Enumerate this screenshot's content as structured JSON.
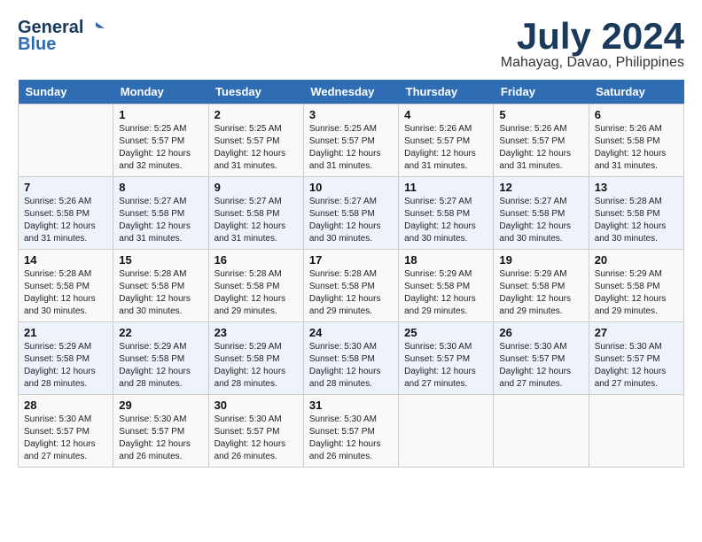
{
  "header": {
    "logo_line1": "General",
    "logo_line2": "Blue",
    "month_year": "July 2024",
    "location": "Mahayag, Davao, Philippines"
  },
  "days_of_week": [
    "Sunday",
    "Monday",
    "Tuesday",
    "Wednesday",
    "Thursday",
    "Friday",
    "Saturday"
  ],
  "weeks": [
    [
      {
        "day": "",
        "info": ""
      },
      {
        "day": "1",
        "info": "Sunrise: 5:25 AM\nSunset: 5:57 PM\nDaylight: 12 hours\nand 32 minutes."
      },
      {
        "day": "2",
        "info": "Sunrise: 5:25 AM\nSunset: 5:57 PM\nDaylight: 12 hours\nand 31 minutes."
      },
      {
        "day": "3",
        "info": "Sunrise: 5:25 AM\nSunset: 5:57 PM\nDaylight: 12 hours\nand 31 minutes."
      },
      {
        "day": "4",
        "info": "Sunrise: 5:26 AM\nSunset: 5:57 PM\nDaylight: 12 hours\nand 31 minutes."
      },
      {
        "day": "5",
        "info": "Sunrise: 5:26 AM\nSunset: 5:57 PM\nDaylight: 12 hours\nand 31 minutes."
      },
      {
        "day": "6",
        "info": "Sunrise: 5:26 AM\nSunset: 5:58 PM\nDaylight: 12 hours\nand 31 minutes."
      }
    ],
    [
      {
        "day": "7",
        "info": "Sunrise: 5:26 AM\nSunset: 5:58 PM\nDaylight: 12 hours\nand 31 minutes."
      },
      {
        "day": "8",
        "info": "Sunrise: 5:27 AM\nSunset: 5:58 PM\nDaylight: 12 hours\nand 31 minutes."
      },
      {
        "day": "9",
        "info": "Sunrise: 5:27 AM\nSunset: 5:58 PM\nDaylight: 12 hours\nand 31 minutes."
      },
      {
        "day": "10",
        "info": "Sunrise: 5:27 AM\nSunset: 5:58 PM\nDaylight: 12 hours\nand 30 minutes."
      },
      {
        "day": "11",
        "info": "Sunrise: 5:27 AM\nSunset: 5:58 PM\nDaylight: 12 hours\nand 30 minutes."
      },
      {
        "day": "12",
        "info": "Sunrise: 5:27 AM\nSunset: 5:58 PM\nDaylight: 12 hours\nand 30 minutes."
      },
      {
        "day": "13",
        "info": "Sunrise: 5:28 AM\nSunset: 5:58 PM\nDaylight: 12 hours\nand 30 minutes."
      }
    ],
    [
      {
        "day": "14",
        "info": "Sunrise: 5:28 AM\nSunset: 5:58 PM\nDaylight: 12 hours\nand 30 minutes."
      },
      {
        "day": "15",
        "info": "Sunrise: 5:28 AM\nSunset: 5:58 PM\nDaylight: 12 hours\nand 30 minutes."
      },
      {
        "day": "16",
        "info": "Sunrise: 5:28 AM\nSunset: 5:58 PM\nDaylight: 12 hours\nand 29 minutes."
      },
      {
        "day": "17",
        "info": "Sunrise: 5:28 AM\nSunset: 5:58 PM\nDaylight: 12 hours\nand 29 minutes."
      },
      {
        "day": "18",
        "info": "Sunrise: 5:29 AM\nSunset: 5:58 PM\nDaylight: 12 hours\nand 29 minutes."
      },
      {
        "day": "19",
        "info": "Sunrise: 5:29 AM\nSunset: 5:58 PM\nDaylight: 12 hours\nand 29 minutes."
      },
      {
        "day": "20",
        "info": "Sunrise: 5:29 AM\nSunset: 5:58 PM\nDaylight: 12 hours\nand 29 minutes."
      }
    ],
    [
      {
        "day": "21",
        "info": "Sunrise: 5:29 AM\nSunset: 5:58 PM\nDaylight: 12 hours\nand 28 minutes."
      },
      {
        "day": "22",
        "info": "Sunrise: 5:29 AM\nSunset: 5:58 PM\nDaylight: 12 hours\nand 28 minutes."
      },
      {
        "day": "23",
        "info": "Sunrise: 5:29 AM\nSunset: 5:58 PM\nDaylight: 12 hours\nand 28 minutes."
      },
      {
        "day": "24",
        "info": "Sunrise: 5:30 AM\nSunset: 5:58 PM\nDaylight: 12 hours\nand 28 minutes."
      },
      {
        "day": "25",
        "info": "Sunrise: 5:30 AM\nSunset: 5:57 PM\nDaylight: 12 hours\nand 27 minutes."
      },
      {
        "day": "26",
        "info": "Sunrise: 5:30 AM\nSunset: 5:57 PM\nDaylight: 12 hours\nand 27 minutes."
      },
      {
        "day": "27",
        "info": "Sunrise: 5:30 AM\nSunset: 5:57 PM\nDaylight: 12 hours\nand 27 minutes."
      }
    ],
    [
      {
        "day": "28",
        "info": "Sunrise: 5:30 AM\nSunset: 5:57 PM\nDaylight: 12 hours\nand 27 minutes."
      },
      {
        "day": "29",
        "info": "Sunrise: 5:30 AM\nSunset: 5:57 PM\nDaylight: 12 hours\nand 26 minutes."
      },
      {
        "day": "30",
        "info": "Sunrise: 5:30 AM\nSunset: 5:57 PM\nDaylight: 12 hours\nand 26 minutes."
      },
      {
        "day": "31",
        "info": "Sunrise: 5:30 AM\nSunset: 5:57 PM\nDaylight: 12 hours\nand 26 minutes."
      },
      {
        "day": "",
        "info": ""
      },
      {
        "day": "",
        "info": ""
      },
      {
        "day": "",
        "info": ""
      }
    ]
  ]
}
